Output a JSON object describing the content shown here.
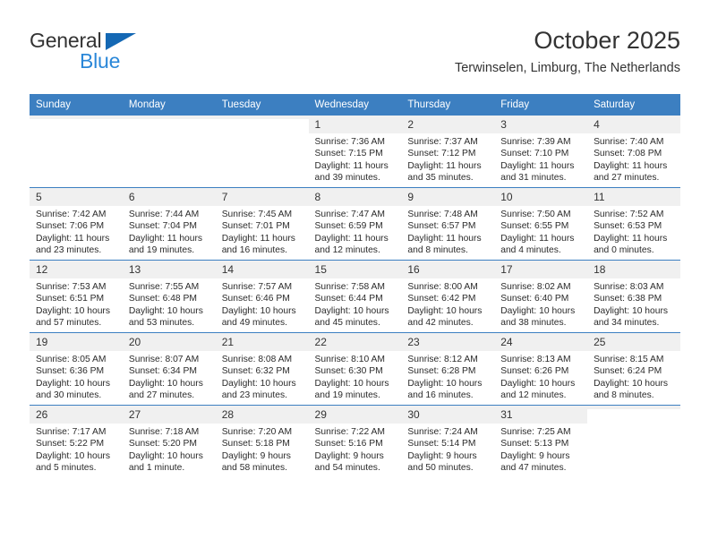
{
  "brand": {
    "word1": "General",
    "word2": "Blue",
    "triangle_color": "#1468b4",
    "word2_color": "#2a87d8"
  },
  "header": {
    "title": "October 2025",
    "subtitle": "Terwinselen, Limburg, The Netherlands"
  },
  "theme": {
    "header_bg": "#3c7fc1",
    "header_text": "#ffffff",
    "daynum_bg": "#f0f0f0",
    "row_rule": "#3c7fc1"
  },
  "weekday_headers": [
    "Sunday",
    "Monday",
    "Tuesday",
    "Wednesday",
    "Thursday",
    "Friday",
    "Saturday"
  ],
  "weeks": [
    [
      {
        "day": "",
        "lines": []
      },
      {
        "day": "",
        "lines": []
      },
      {
        "day": "",
        "lines": []
      },
      {
        "day": "1",
        "lines": [
          "Sunrise: 7:36 AM",
          "Sunset: 7:15 PM",
          "Daylight: 11 hours",
          "and 39 minutes."
        ]
      },
      {
        "day": "2",
        "lines": [
          "Sunrise: 7:37 AM",
          "Sunset: 7:12 PM",
          "Daylight: 11 hours",
          "and 35 minutes."
        ]
      },
      {
        "day": "3",
        "lines": [
          "Sunrise: 7:39 AM",
          "Sunset: 7:10 PM",
          "Daylight: 11 hours",
          "and 31 minutes."
        ]
      },
      {
        "day": "4",
        "lines": [
          "Sunrise: 7:40 AM",
          "Sunset: 7:08 PM",
          "Daylight: 11 hours",
          "and 27 minutes."
        ]
      }
    ],
    [
      {
        "day": "5",
        "lines": [
          "Sunrise: 7:42 AM",
          "Sunset: 7:06 PM",
          "Daylight: 11 hours",
          "and 23 minutes."
        ]
      },
      {
        "day": "6",
        "lines": [
          "Sunrise: 7:44 AM",
          "Sunset: 7:04 PM",
          "Daylight: 11 hours",
          "and 19 minutes."
        ]
      },
      {
        "day": "7",
        "lines": [
          "Sunrise: 7:45 AM",
          "Sunset: 7:01 PM",
          "Daylight: 11 hours",
          "and 16 minutes."
        ]
      },
      {
        "day": "8",
        "lines": [
          "Sunrise: 7:47 AM",
          "Sunset: 6:59 PM",
          "Daylight: 11 hours",
          "and 12 minutes."
        ]
      },
      {
        "day": "9",
        "lines": [
          "Sunrise: 7:48 AM",
          "Sunset: 6:57 PM",
          "Daylight: 11 hours",
          "and 8 minutes."
        ]
      },
      {
        "day": "10",
        "lines": [
          "Sunrise: 7:50 AM",
          "Sunset: 6:55 PM",
          "Daylight: 11 hours",
          "and 4 minutes."
        ]
      },
      {
        "day": "11",
        "lines": [
          "Sunrise: 7:52 AM",
          "Sunset: 6:53 PM",
          "Daylight: 11 hours",
          "and 0 minutes."
        ]
      }
    ],
    [
      {
        "day": "12",
        "lines": [
          "Sunrise: 7:53 AM",
          "Sunset: 6:51 PM",
          "Daylight: 10 hours",
          "and 57 minutes."
        ]
      },
      {
        "day": "13",
        "lines": [
          "Sunrise: 7:55 AM",
          "Sunset: 6:48 PM",
          "Daylight: 10 hours",
          "and 53 minutes."
        ]
      },
      {
        "day": "14",
        "lines": [
          "Sunrise: 7:57 AM",
          "Sunset: 6:46 PM",
          "Daylight: 10 hours",
          "and 49 minutes."
        ]
      },
      {
        "day": "15",
        "lines": [
          "Sunrise: 7:58 AM",
          "Sunset: 6:44 PM",
          "Daylight: 10 hours",
          "and 45 minutes."
        ]
      },
      {
        "day": "16",
        "lines": [
          "Sunrise: 8:00 AM",
          "Sunset: 6:42 PM",
          "Daylight: 10 hours",
          "and 42 minutes."
        ]
      },
      {
        "day": "17",
        "lines": [
          "Sunrise: 8:02 AM",
          "Sunset: 6:40 PM",
          "Daylight: 10 hours",
          "and 38 minutes."
        ]
      },
      {
        "day": "18",
        "lines": [
          "Sunrise: 8:03 AM",
          "Sunset: 6:38 PM",
          "Daylight: 10 hours",
          "and 34 minutes."
        ]
      }
    ],
    [
      {
        "day": "19",
        "lines": [
          "Sunrise: 8:05 AM",
          "Sunset: 6:36 PM",
          "Daylight: 10 hours",
          "and 30 minutes."
        ]
      },
      {
        "day": "20",
        "lines": [
          "Sunrise: 8:07 AM",
          "Sunset: 6:34 PM",
          "Daylight: 10 hours",
          "and 27 minutes."
        ]
      },
      {
        "day": "21",
        "lines": [
          "Sunrise: 8:08 AM",
          "Sunset: 6:32 PM",
          "Daylight: 10 hours",
          "and 23 minutes."
        ]
      },
      {
        "day": "22",
        "lines": [
          "Sunrise: 8:10 AM",
          "Sunset: 6:30 PM",
          "Daylight: 10 hours",
          "and 19 minutes."
        ]
      },
      {
        "day": "23",
        "lines": [
          "Sunrise: 8:12 AM",
          "Sunset: 6:28 PM",
          "Daylight: 10 hours",
          "and 16 minutes."
        ]
      },
      {
        "day": "24",
        "lines": [
          "Sunrise: 8:13 AM",
          "Sunset: 6:26 PM",
          "Daylight: 10 hours",
          "and 12 minutes."
        ]
      },
      {
        "day": "25",
        "lines": [
          "Sunrise: 8:15 AM",
          "Sunset: 6:24 PM",
          "Daylight: 10 hours",
          "and 8 minutes."
        ]
      }
    ],
    [
      {
        "day": "26",
        "lines": [
          "Sunrise: 7:17 AM",
          "Sunset: 5:22 PM",
          "Daylight: 10 hours",
          "and 5 minutes."
        ]
      },
      {
        "day": "27",
        "lines": [
          "Sunrise: 7:18 AM",
          "Sunset: 5:20 PM",
          "Daylight: 10 hours",
          "and 1 minute."
        ]
      },
      {
        "day": "28",
        "lines": [
          "Sunrise: 7:20 AM",
          "Sunset: 5:18 PM",
          "Daylight: 9 hours",
          "and 58 minutes."
        ]
      },
      {
        "day": "29",
        "lines": [
          "Sunrise: 7:22 AM",
          "Sunset: 5:16 PM",
          "Daylight: 9 hours",
          "and 54 minutes."
        ]
      },
      {
        "day": "30",
        "lines": [
          "Sunrise: 7:24 AM",
          "Sunset: 5:14 PM",
          "Daylight: 9 hours",
          "and 50 minutes."
        ]
      },
      {
        "day": "31",
        "lines": [
          "Sunrise: 7:25 AM",
          "Sunset: 5:13 PM",
          "Daylight: 9 hours",
          "and 47 minutes."
        ]
      },
      {
        "day": "",
        "lines": []
      }
    ]
  ]
}
